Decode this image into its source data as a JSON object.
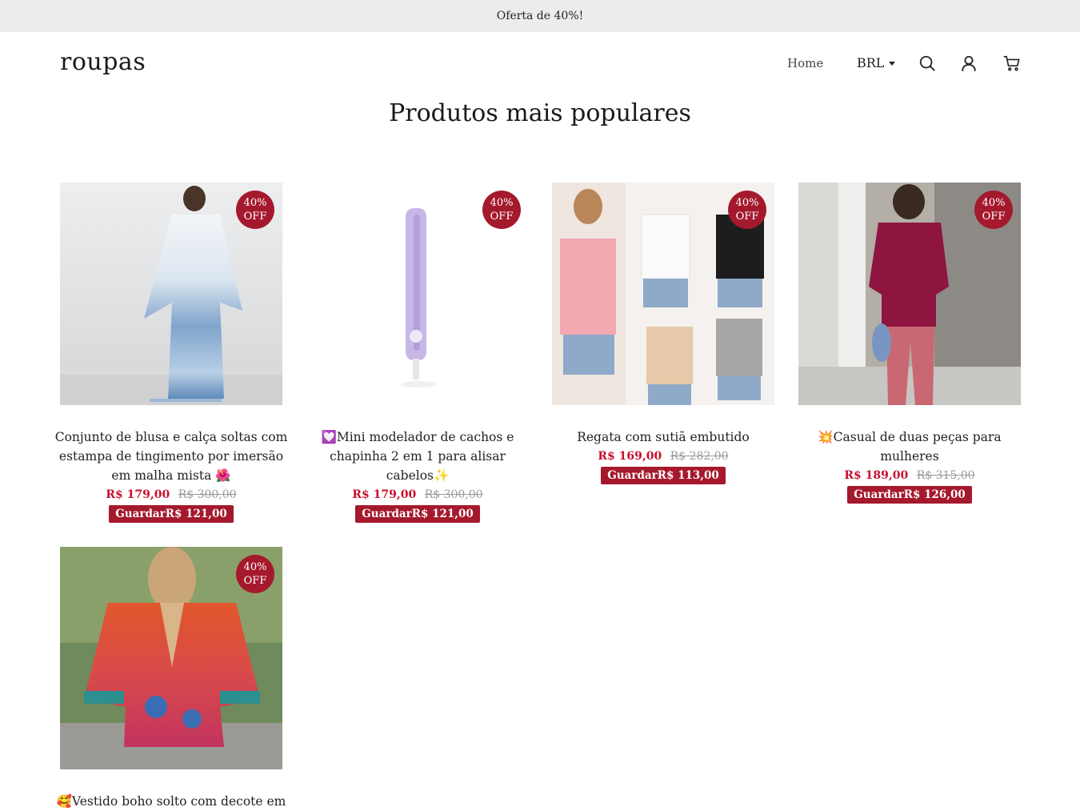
{
  "announcement": "Oferta de 40%!",
  "header": {
    "logo": "roupas",
    "nav_home": "Home",
    "currency": "BRL",
    "icons": [
      "search-icon",
      "account-icon",
      "cart-icon"
    ]
  },
  "section_title": "Produtos mais populares",
  "colors": {
    "accent": "#a5192d",
    "price": "#c8102e",
    "announce_bg": "#ececec"
  },
  "products": [
    {
      "name": "Conjunto de blusa e calça soltas com estampa de tingimento por imersão em malha mista 🌺",
      "price": "R$ 179,00",
      "compare": "R$ 300,00",
      "save": "GuardarR$ 121,00",
      "badge1": "40%",
      "badge2": "OFF"
    },
    {
      "name": "💟Mini modelador de cachos e chapinha 2 em 1 para alisar cabelos✨",
      "price": "R$ 179,00",
      "compare": "R$ 300,00",
      "save": "GuardarR$ 121,00",
      "badge1": "40%",
      "badge2": "OFF"
    },
    {
      "name": "Regata com sutiã embutido",
      "price": "R$ 169,00",
      "compare": "R$ 282,00",
      "save": "GuardarR$ 113,00",
      "badge1": "40%",
      "badge2": "OFF"
    },
    {
      "name": "💥Casual de duas peças para mulheres",
      "price": "R$ 189,00",
      "compare": "R$ 315,00",
      "save": "GuardarR$ 126,00",
      "badge1": "40%",
      "badge2": "OFF"
    },
    {
      "name": "🥰Vestido boho solto com decote em V",
      "badge1": "40%",
      "badge2": "OFF"
    }
  ]
}
